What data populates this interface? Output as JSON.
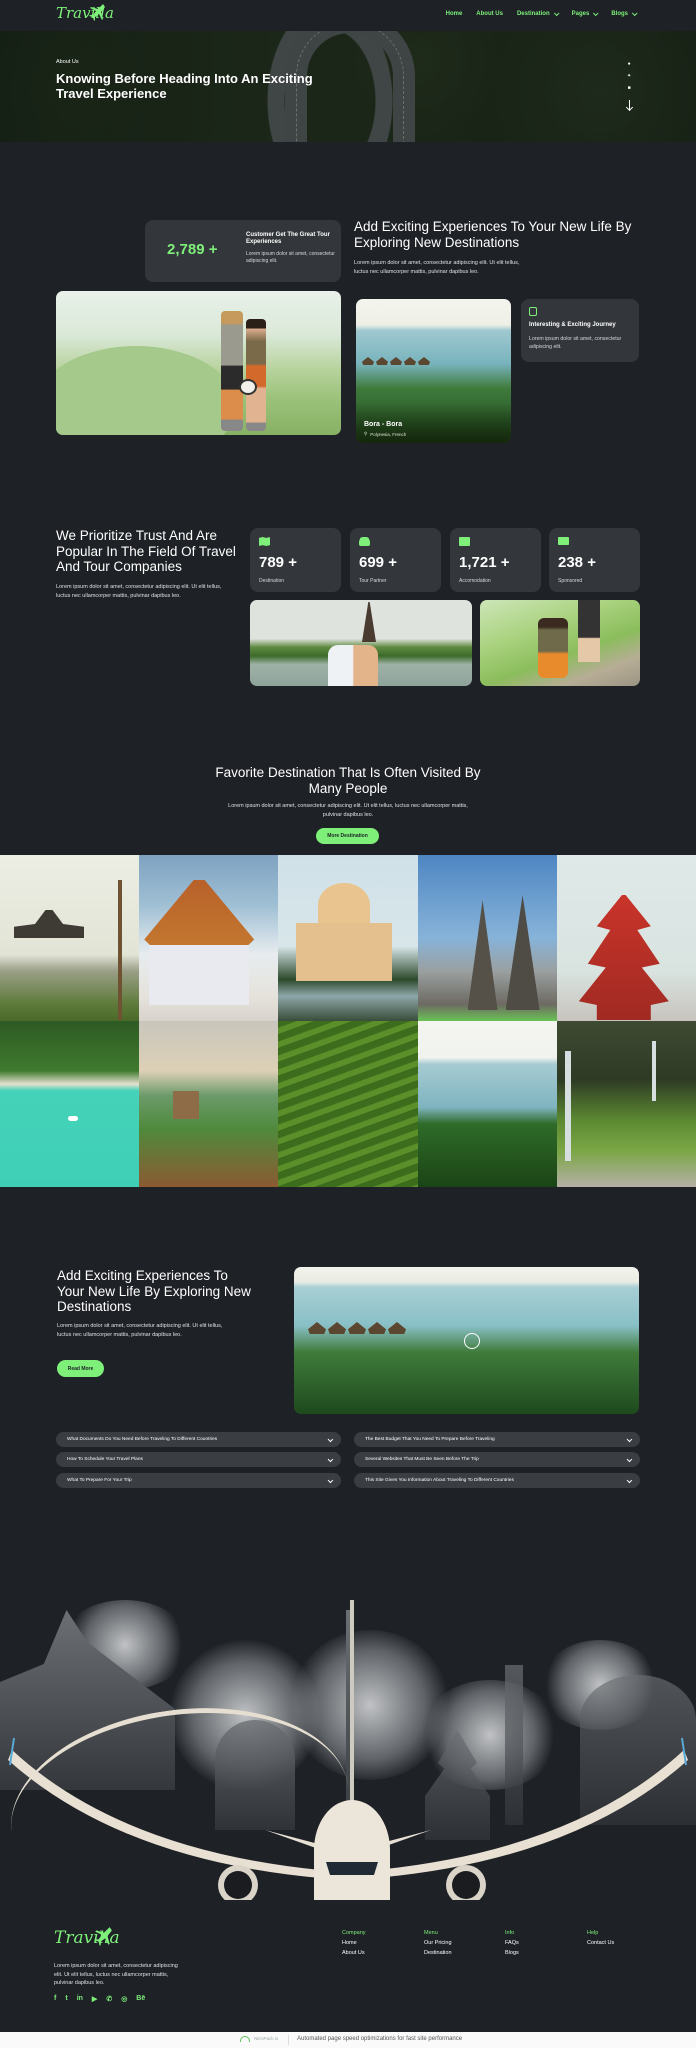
{
  "header": {
    "logo": "Travilla",
    "nav": [
      {
        "label": "Home",
        "has_dropdown": false
      },
      {
        "label": "About Us",
        "has_dropdown": false
      },
      {
        "label": "Destination",
        "has_dropdown": true
      },
      {
        "label": "Pages",
        "has_dropdown": true
      },
      {
        "label": "Blogs",
        "has_dropdown": true
      }
    ]
  },
  "hero": {
    "eyebrow": "About Us",
    "title": "Knowing Before Heading Into An Exciting Travel Experience",
    "social_icons": [
      "facebook-icon",
      "twitter-icon",
      "youtube-icon"
    ]
  },
  "experience": {
    "stat_value": "2,789 +",
    "stat_title": "Customer Get The Great Tour Experiences",
    "stat_desc": "Lorem ipsum dolor sit amet, consectetur adipiscing elit.",
    "heading": "Add Exciting Experiences To Your New Life By Exploring New Destinations",
    "paragraph": "Lorem ipsum dolor sit amet, consectetur adipiscing elit. Ut elit tellus, luctus nec ullamcorper mattis, pulvinar dapibus leo.",
    "featured": {
      "name": "Bora - Bora",
      "location": "Polynesia, French"
    },
    "journey_card": {
      "title": "Interesting & Exciting Journey",
      "desc": "Lorem ipsum dolor sit amet, consectetur adipiscing elit."
    }
  },
  "trust": {
    "heading": "We Prioritize Trust And Are Popular In The Field Of Travel And Tour Companies",
    "paragraph": "Lorem ipsum dolor sit amet, consectetur adipiscing elit. Ut elit tellus, luctus nec ullamcorper mattis, pulvinar dapibus leo.",
    "stats": [
      {
        "icon": "map-icon",
        "value": "789 +",
        "label": "Destination"
      },
      {
        "icon": "car-icon",
        "value": "699 +",
        "label": "Tour Partner"
      },
      {
        "icon": "building-icon",
        "value": "1,721 +",
        "label": "Accomodation"
      },
      {
        "icon": "envelope-icon",
        "value": "238 +",
        "label": "Sponsored"
      }
    ]
  },
  "favorites": {
    "heading": "Favorite Destination That Is Often Visited By Many People",
    "paragraph": "Lorem ipsum dolor sit amet, consectetur adipiscing elit. Ut elit tellus, luctus nec ullamcorper mattis, pulvinar dapibus leo.",
    "button": "More Destination",
    "gallery": [
      "lake-temple",
      "thai-temple",
      "taj-mahal",
      "prambanan-temple",
      "red-pagoda",
      "tropical-beach",
      "great-wall",
      "rice-terraces",
      "overwater-bungalows",
      "waterfall-cliffs"
    ]
  },
  "about": {
    "heading": "Add Exciting Experiences To Your New Life By Exploring New Destinations",
    "paragraph": "Lorem ipsum dolor sit amet, consectetur adipiscing elit. Ut elit tellus, luctus nec ullamcorper mattis, pulvinar dapibus leo.",
    "button": "Read More"
  },
  "faq": {
    "left": [
      "What Documents Do You Need Before Traveling To Different Countries",
      "How To Schedule Your Travel Plans",
      "What To Prepare For Your Trip"
    ],
    "right": [
      "The Best Budget That You Need To Prepare Before Traveling",
      "Several Websites That Must Be Seen Before The Trip",
      "This Site Gives You Information About Traveling To Different Countries"
    ]
  },
  "footer": {
    "logo": "Travilla",
    "description": "Lorem ipsum dolor sit amet, consectetur adipiscing elit. Ut elit tellus, luctus nec ullamcorper mattis, pulvinar dapibus leo.",
    "socials": [
      {
        "icon": "facebook-icon",
        "glyph": "f"
      },
      {
        "icon": "twitter-icon",
        "glyph": "t"
      },
      {
        "icon": "linkedin-icon",
        "glyph": "in"
      },
      {
        "icon": "youtube-icon",
        "glyph": "▶"
      },
      {
        "icon": "whatsapp-icon",
        "glyph": "✆"
      },
      {
        "icon": "instagram-icon",
        "glyph": "◎"
      },
      {
        "icon": "behance-icon",
        "glyph": "Bē"
      }
    ],
    "columns": [
      {
        "heading": "Company",
        "links": [
          "Home",
          "About Us"
        ]
      },
      {
        "heading": "Menu",
        "links": [
          "Our Pricing",
          "Destination"
        ]
      },
      {
        "heading": "Info",
        "links": [
          "FAQs",
          "Blogs"
        ]
      },
      {
        "heading": "Help",
        "links": [
          "Contact Us"
        ]
      }
    ]
  },
  "bottom_bar": {
    "badge": "NitroPack.io",
    "text": "Automated page speed optimizations for fast site performance"
  },
  "colors": {
    "accent": "#7ef07a",
    "background": "#1e2126",
    "card": "#33363b"
  }
}
